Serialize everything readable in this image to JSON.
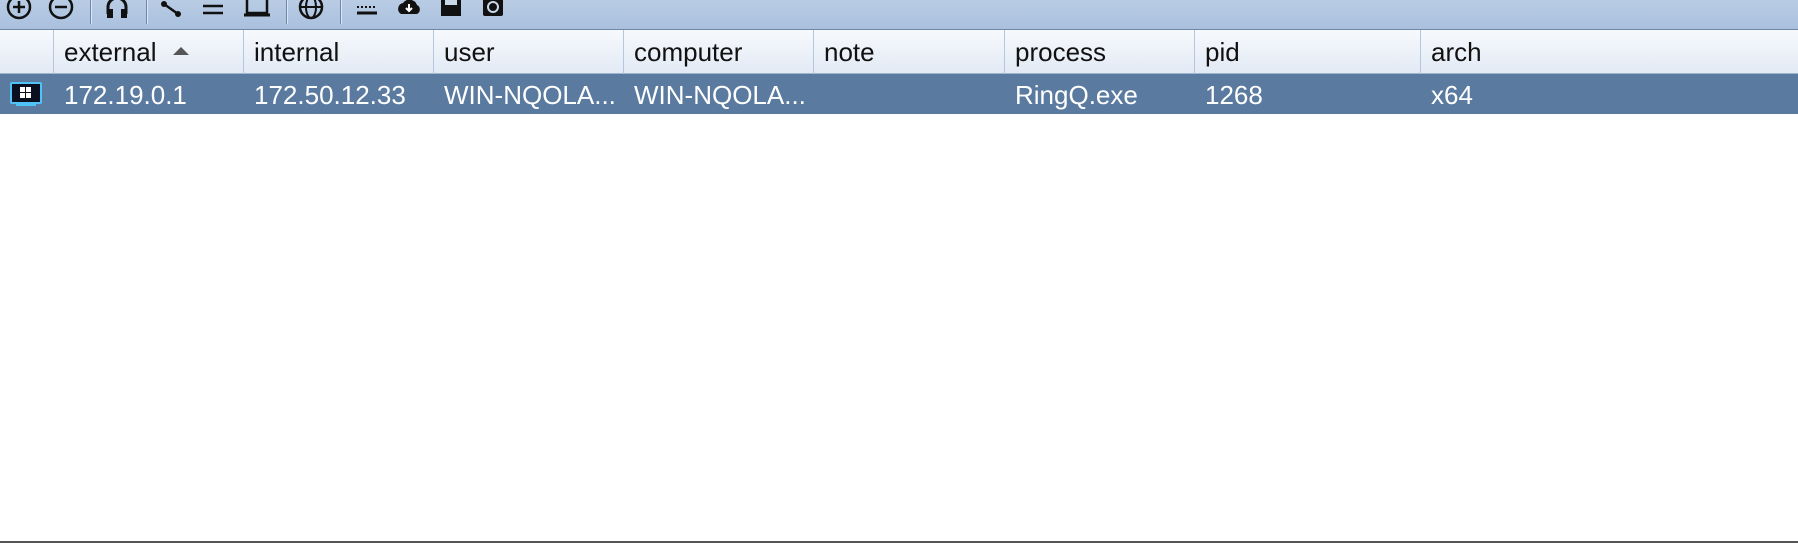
{
  "toolbar": {
    "icons": [
      "plus-circle-icon",
      "minus-circle-icon",
      "headphones-icon",
      "share-icon",
      "list-icon",
      "screen-icon",
      "globe-icon",
      "keys-icon",
      "cloud-download-icon",
      "save-icon",
      "camera-icon"
    ]
  },
  "table": {
    "columns": [
      "",
      "external",
      "internal",
      "user",
      "computer",
      "note",
      "process",
      "pid",
      "arch"
    ],
    "sorted_column": "external",
    "sort_direction": "ascending",
    "rows": [
      {
        "icon": "windows-session-icon",
        "external": "172.19.0.1",
        "internal": "172.50.12.33",
        "user": "WIN-NQOLA...",
        "computer": "WIN-NQOLA...",
        "note": "",
        "process": "RingQ.exe",
        "pid": "1268",
        "arch": "x64"
      }
    ]
  },
  "colors": {
    "toolbar_bg": "#aec4e0",
    "selected_row": "#5a7aa0",
    "header_bg": "#eaf0f8"
  }
}
